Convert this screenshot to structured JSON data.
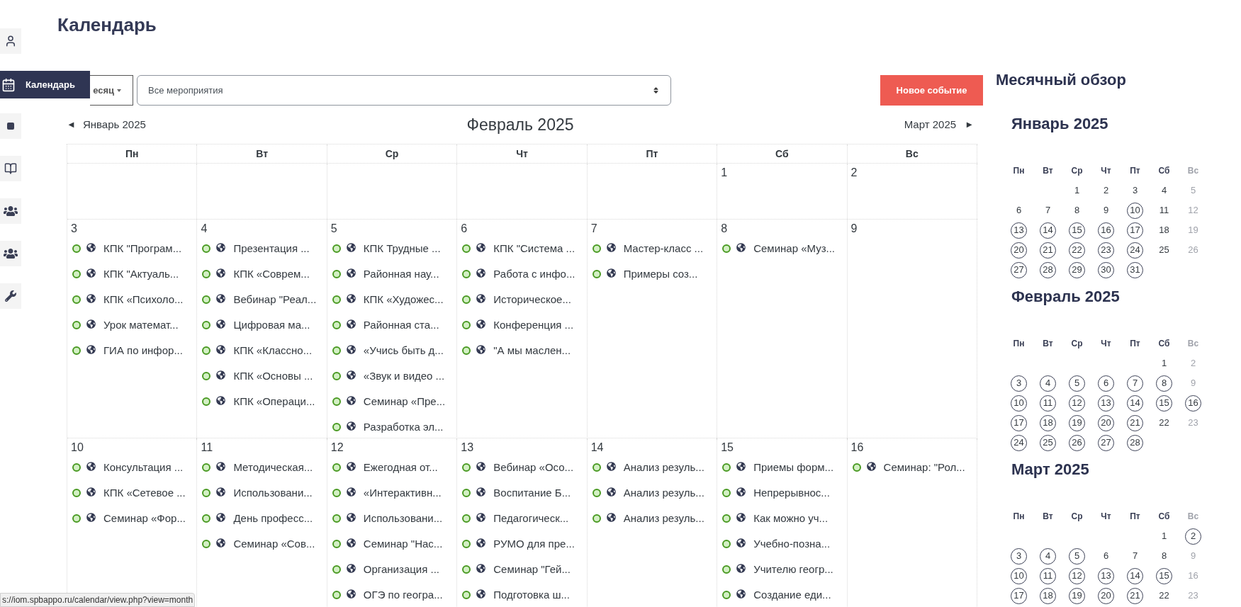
{
  "page_title": "Календарь",
  "sidebar": {
    "tooltip": "Календарь"
  },
  "toolbar": {
    "view_select": "есяц",
    "filter_select": "Все мероприятия",
    "new_event_button": "Новое событие"
  },
  "navigation": {
    "prev": "Январь 2025",
    "current": "Февраль 2025",
    "next": "Март 2025",
    "prev_arrow": "◄",
    "next_arrow": "►"
  },
  "weekdays": [
    "Пн",
    "Вт",
    "Ср",
    "Чт",
    "Пт",
    "Сб",
    "Вс"
  ],
  "weeks": [
    {
      "days": [
        {
          "kind": "blank"
        },
        {
          "kind": "blank"
        },
        {
          "kind": "blank"
        },
        {
          "kind": "blank"
        },
        {
          "kind": "blank"
        },
        {
          "kind": "day",
          "date": "1"
        },
        {
          "kind": "day",
          "date": "2"
        }
      ]
    },
    {
      "days": [
        {
          "kind": "day",
          "date": "3",
          "events": [
            "КПК \"Програм...",
            "КПК \"Актуаль...",
            "КПК «Психоло...",
            "Урок математ...",
            "ГИА по инфор..."
          ]
        },
        {
          "kind": "day",
          "date": "4",
          "events": [
            "Презентация ...",
            "КПК «Соврем...",
            "Вебинар \"Реал...",
            "Цифровая ма...",
            "КПК «Классно...",
            "КПК «Основы ...",
            "КПК «Операци..."
          ]
        },
        {
          "kind": "day",
          "date": "5",
          "events": [
            "КПК Трудные ...",
            "Районная нау...",
            "КПК «Художес...",
            "Районная ста...",
            "«Учись быть д...",
            "«Звук и видео ...",
            "Семинар «Пре...",
            "Разработка эл..."
          ]
        },
        {
          "kind": "day",
          "date": "6",
          "events": [
            "КПК \"Система ...",
            "Работа с инфо...",
            "Историческое...",
            "Конференция ...",
            "\"А мы маслен..."
          ]
        },
        {
          "kind": "day",
          "date": "7",
          "events": [
            "Мастер-класс ...",
            "Примеры соз..."
          ]
        },
        {
          "kind": "day",
          "date": "8",
          "events": [
            "Семинар «Муз..."
          ]
        },
        {
          "kind": "day",
          "date": "9"
        }
      ]
    },
    {
      "days": [
        {
          "kind": "day",
          "date": "10",
          "events": [
            "Консультация ...",
            "КПК «Сетевое ...",
            "Семинар «Фор..."
          ]
        },
        {
          "kind": "day",
          "date": "11",
          "events": [
            "Методическая...",
            "Использовани...",
            "День професс...",
            "Семинар «Сов..."
          ]
        },
        {
          "kind": "day",
          "date": "12",
          "events": [
            "Ежегодная от...",
            "«Интерактивн...",
            "Использовани...",
            "Семинар \"Нас...",
            "Организация ...",
            "ОГЭ по геогра..."
          ]
        },
        {
          "kind": "day",
          "date": "13",
          "events": [
            "Вебинар «Осо...",
            "Воспитание Б...",
            "Педагогическ...",
            "РУМО для пре...",
            "Семинар \"Гей...",
            "Подготовка ш..."
          ]
        },
        {
          "kind": "day",
          "date": "14",
          "events": [
            "Анализ резуль...",
            "Анализ резуль...",
            "Анализ резуль..."
          ]
        },
        {
          "kind": "day",
          "date": "15",
          "events": [
            "Приемы форм...",
            "Непрерывнос...",
            "Как можно уч...",
            "Учебно-позна...",
            "Учителю геогр...",
            "Создание еди..."
          ]
        },
        {
          "kind": "day",
          "date": "16",
          "events": [
            "Семинар: \"Рол..."
          ]
        }
      ]
    }
  ],
  "overview": {
    "title": "Месячный обзор",
    "months": [
      {
        "title": "Январь 2025",
        "weekdays": [
          "Пн",
          "Вт",
          "Ср",
          "Чт",
          "Пт",
          "Сб",
          "Вс"
        ],
        "weeks": [
          [
            {
              "kind": "blank"
            },
            {
              "kind": "blank"
            },
            {
              "kind": "day",
              "day": "1",
              "has_events": false
            },
            {
              "kind": "day",
              "day": "2",
              "has_events": false
            },
            {
              "kind": "day",
              "day": "3",
              "has_events": false
            },
            {
              "kind": "day",
              "day": "4",
              "has_events": false
            },
            {
              "kind": "day",
              "day": "5",
              "has_events": false
            }
          ],
          [
            {
              "kind": "day",
              "day": "6",
              "has_events": false
            },
            {
              "kind": "day",
              "day": "7",
              "has_events": false
            },
            {
              "kind": "day",
              "day": "8",
              "has_events": false
            },
            {
              "kind": "day",
              "day": "9",
              "has_events": false
            },
            {
              "kind": "day",
              "day": "10",
              "has_events": true
            },
            {
              "kind": "day",
              "day": "11",
              "has_events": false
            },
            {
              "kind": "day",
              "day": "12",
              "has_events": false
            }
          ],
          [
            {
              "kind": "day",
              "day": "13",
              "has_events": true
            },
            {
              "kind": "day",
              "day": "14",
              "has_events": true
            },
            {
              "kind": "day",
              "day": "15",
              "has_events": true
            },
            {
              "kind": "day",
              "day": "16",
              "has_events": true
            },
            {
              "kind": "day",
              "day": "17",
              "has_events": true
            },
            {
              "kind": "day",
              "day": "18",
              "has_events": false
            },
            {
              "kind": "day",
              "day": "19",
              "has_events": false
            }
          ],
          [
            {
              "kind": "day",
              "day": "20",
              "has_events": true
            },
            {
              "kind": "day",
              "day": "21",
              "has_events": true
            },
            {
              "kind": "day",
              "day": "22",
              "has_events": true
            },
            {
              "kind": "day",
              "day": "23",
              "has_events": true
            },
            {
              "kind": "day",
              "day": "24",
              "has_events": true
            },
            {
              "kind": "day",
              "day": "25",
              "has_events": false
            },
            {
              "kind": "day",
              "day": "26",
              "has_events": false
            }
          ],
          [
            {
              "kind": "day",
              "day": "27",
              "has_events": true
            },
            {
              "kind": "day",
              "day": "28",
              "has_events": true
            },
            {
              "kind": "day",
              "day": "29",
              "has_events": true
            },
            {
              "kind": "day",
              "day": "30",
              "has_events": true
            },
            {
              "kind": "day",
              "day": "31",
              "has_events": true
            },
            {
              "kind": "blank"
            },
            {
              "kind": "blank"
            }
          ]
        ]
      },
      {
        "title": "Февраль 2025",
        "weekdays": [
          "Пн",
          "Вт",
          "Ср",
          "Чт",
          "Пт",
          "Сб",
          "Вс"
        ],
        "weeks": [
          [
            {
              "kind": "blank"
            },
            {
              "kind": "blank"
            },
            {
              "kind": "blank"
            },
            {
              "kind": "blank"
            },
            {
              "kind": "blank"
            },
            {
              "kind": "day",
              "day": "1",
              "has_events": false
            },
            {
              "kind": "day",
              "day": "2",
              "has_events": false
            }
          ],
          [
            {
              "kind": "day",
              "day": "3",
              "has_events": true
            },
            {
              "kind": "day",
              "day": "4",
              "has_events": true
            },
            {
              "kind": "day",
              "day": "5",
              "has_events": true
            },
            {
              "kind": "day",
              "day": "6",
              "has_events": true
            },
            {
              "kind": "day",
              "day": "7",
              "has_events": true
            },
            {
              "kind": "day",
              "day": "8",
              "has_events": true
            },
            {
              "kind": "day",
              "day": "9",
              "has_events": false
            }
          ],
          [
            {
              "kind": "day",
              "day": "10",
              "has_events": true
            },
            {
              "kind": "day",
              "day": "11",
              "has_events": true
            },
            {
              "kind": "day",
              "day": "12",
              "has_events": true
            },
            {
              "kind": "day",
              "day": "13",
              "has_events": true
            },
            {
              "kind": "day",
              "day": "14",
              "has_events": true
            },
            {
              "kind": "day",
              "day": "15",
              "has_events": true
            },
            {
              "kind": "day",
              "day": "16",
              "has_events": true
            }
          ],
          [
            {
              "kind": "day",
              "day": "17",
              "has_events": true
            },
            {
              "kind": "day",
              "day": "18",
              "has_events": true
            },
            {
              "kind": "day",
              "day": "19",
              "has_events": true
            },
            {
              "kind": "day",
              "day": "20",
              "has_events": true
            },
            {
              "kind": "day",
              "day": "21",
              "has_events": true
            },
            {
              "kind": "day",
              "day": "22",
              "has_events": false
            },
            {
              "kind": "day",
              "day": "23",
              "has_events": false
            }
          ],
          [
            {
              "kind": "day",
              "day": "24",
              "has_events": true
            },
            {
              "kind": "day",
              "day": "25",
              "has_events": true
            },
            {
              "kind": "day",
              "day": "26",
              "has_events": true
            },
            {
              "kind": "day",
              "day": "27",
              "has_events": true
            },
            {
              "kind": "day",
              "day": "28",
              "has_events": true
            },
            {
              "kind": "blank"
            },
            {
              "kind": "blank"
            }
          ]
        ]
      },
      {
        "title": "Март 2025",
        "weekdays": [
          "Пн",
          "Вт",
          "Ср",
          "Чт",
          "Пт",
          "Сб",
          "Вс"
        ],
        "weeks": [
          [
            {
              "kind": "blank"
            },
            {
              "kind": "blank"
            },
            {
              "kind": "blank"
            },
            {
              "kind": "blank"
            },
            {
              "kind": "blank"
            },
            {
              "kind": "day",
              "day": "1",
              "has_events": false
            },
            {
              "kind": "day",
              "day": "2",
              "has_events": true
            }
          ],
          [
            {
              "kind": "day",
              "day": "3",
              "has_events": true
            },
            {
              "kind": "day",
              "day": "4",
              "has_events": true
            },
            {
              "kind": "day",
              "day": "5",
              "has_events": true
            },
            {
              "kind": "day",
              "day": "6",
              "has_events": false
            },
            {
              "kind": "day",
              "day": "7",
              "has_events": false
            },
            {
              "kind": "day",
              "day": "8",
              "has_events": false
            },
            {
              "kind": "day",
              "day": "9",
              "has_events": false
            }
          ],
          [
            {
              "kind": "day",
              "day": "10",
              "has_events": true
            },
            {
              "kind": "day",
              "day": "11",
              "has_events": true
            },
            {
              "kind": "day",
              "day": "12",
              "has_events": true
            },
            {
              "kind": "day",
              "day": "13",
              "has_events": true
            },
            {
              "kind": "day",
              "day": "14",
              "has_events": true
            },
            {
              "kind": "day",
              "day": "15",
              "has_events": true
            },
            {
              "kind": "day",
              "day": "16",
              "has_events": false
            }
          ],
          [
            {
              "kind": "day",
              "day": "17",
              "has_events": true
            },
            {
              "kind": "day",
              "day": "18",
              "has_events": true
            },
            {
              "kind": "day",
              "day": "19",
              "has_events": true
            },
            {
              "kind": "day",
              "day": "20",
              "has_events": true
            },
            {
              "kind": "day",
              "day": "21",
              "has_events": true
            },
            {
              "kind": "day",
              "day": "22",
              "has_events": false
            },
            {
              "kind": "day",
              "day": "23",
              "has_events": false
            }
          ]
        ]
      }
    ]
  },
  "status_bar": {
    "url": "s://iom.spbappo.ru/calendar/view.php?view=month"
  }
}
